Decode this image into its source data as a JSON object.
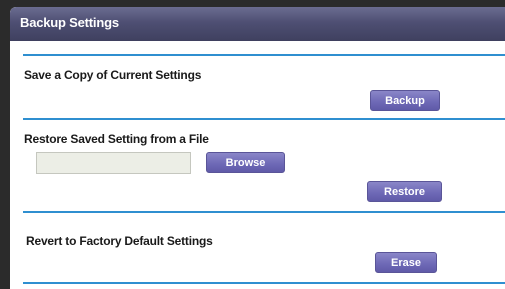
{
  "window": {
    "title": "Backup Settings"
  },
  "sections": {
    "backup": {
      "label": "Save a Copy of Current Settings",
      "button": "Backup"
    },
    "restore": {
      "label": "Restore Saved Setting from a File",
      "file_value": "",
      "browse_button": "Browse",
      "restore_button": "Restore"
    },
    "erase": {
      "label": "Revert to Factory Default Settings",
      "button": "Erase"
    }
  },
  "colors": {
    "header": "#4e4f73",
    "divider": "#2f8fd0",
    "button": "#6f6ab7"
  }
}
